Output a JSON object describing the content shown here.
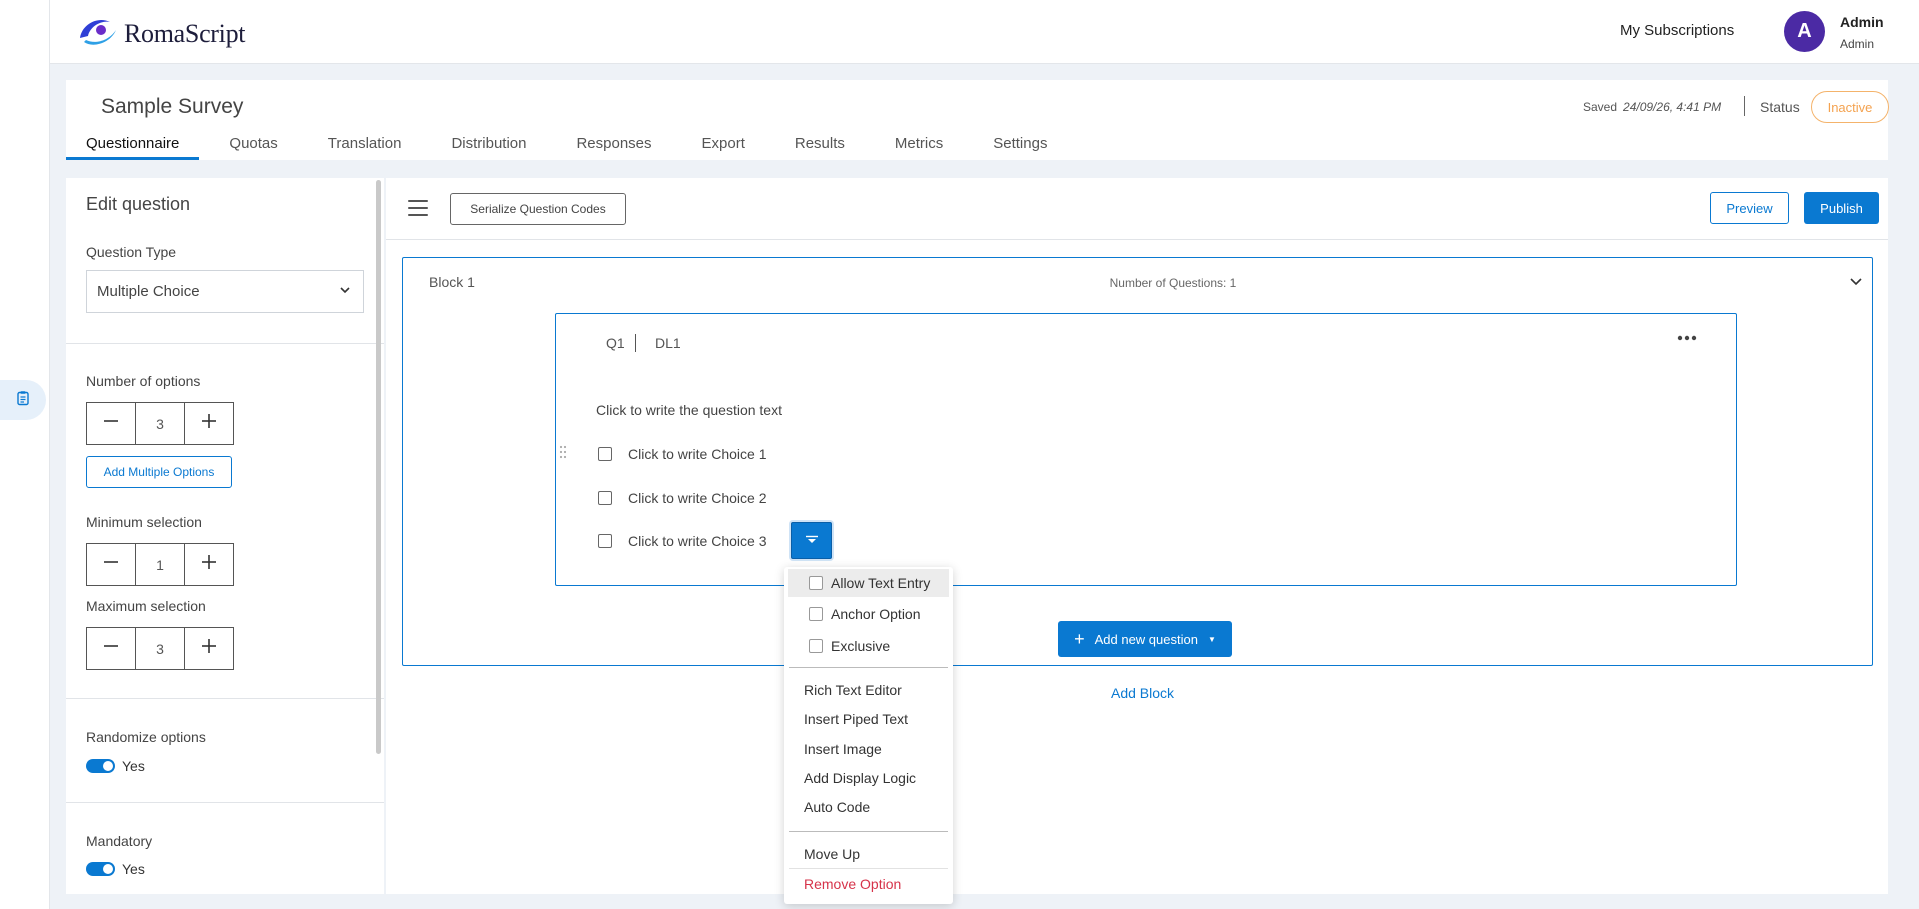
{
  "app": {
    "brand": "RomaScript",
    "subscriptions_link": "My Subscriptions",
    "user": {
      "initial": "A",
      "name": "Admin",
      "role": "Admin"
    }
  },
  "survey": {
    "title": "Sample Survey",
    "saved_label": "Saved",
    "saved_time": "24/09/26, 4:41 PM",
    "status_label": "Status",
    "status_value": "Inactive",
    "tabs": [
      "Questionnaire",
      "Quotas",
      "Translation",
      "Distribution",
      "Responses",
      "Export",
      "Results",
      "Metrics",
      "Settings"
    ],
    "active_tab": "Questionnaire"
  },
  "edit_panel": {
    "title": "Edit question",
    "question_type_label": "Question Type",
    "question_type_value": "Multiple Choice",
    "num_options_label": "Number of options",
    "num_options_value": "3",
    "add_multiple_options": "Add Multiple Options",
    "min_selection_label": "Minimum selection",
    "min_selection_value": "1",
    "max_selection_label": "Maximum selection",
    "max_selection_value": "3",
    "randomize_label": "Randomize options",
    "randomize_value": "Yes",
    "mandatory_label": "Mandatory",
    "mandatory_value": "Yes"
  },
  "toolbar": {
    "serialize": "Serialize Question Codes",
    "preview": "Preview",
    "publish": "Publish"
  },
  "block": {
    "name": "Block 1",
    "count_text": "Number of Questions: 1",
    "question": {
      "code": "Q1",
      "dl": "DL1",
      "text": "Click to write the question text",
      "choices": [
        "Click to write Choice 1",
        "Click to write Choice 2",
        "Click to write Choice 3"
      ]
    },
    "add_question": "Add new question",
    "add_block": "Add Block"
  },
  "choice_menu": {
    "checks": [
      "Allow Text Entry",
      "Anchor Option",
      "Exclusive"
    ],
    "actions": [
      "Rich Text Editor",
      "Insert Piped Text",
      "Insert Image",
      "Add Display Logic",
      "Auto Code"
    ],
    "move_up": "Move Up",
    "remove": "Remove Option"
  },
  "colors": {
    "accent": "#0a79d1",
    "avatar": "#4b2aa4",
    "status_inactive": "#f4a24f",
    "danger": "#d6334a"
  }
}
